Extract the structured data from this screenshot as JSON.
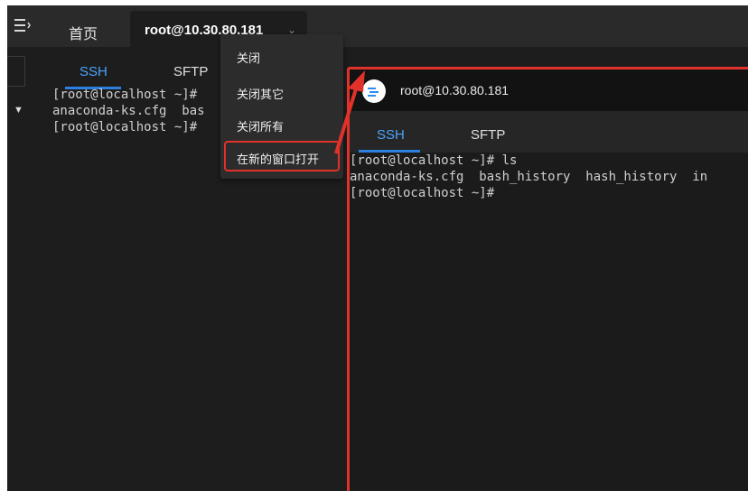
{
  "topbar": {
    "menu_icon": "hamburger-menu-icon",
    "home_tab": "首页",
    "session_tab": "root@10.30.80.181",
    "session_tab_chevron": "⌄"
  },
  "left_pane": {
    "tabs": [
      "SSH",
      "SFTP"
    ],
    "terminal_lines": [
      "[root@localhost ~]#",
      "anaconda-ks.cfg  bas",
      "[root@localhost ~]#"
    ],
    "caret": "▼"
  },
  "context_menu": {
    "items": [
      "关闭",
      "关闭其它",
      "关闭所有",
      "在新的窗口打开"
    ]
  },
  "new_window": {
    "title": "root@10.30.80.181",
    "logo_icon": "app-logo-icon",
    "tabs": [
      "SSH",
      "SFTP"
    ],
    "terminal_lines": [
      "[root@localhost ~]# ls",
      "anaconda-ks.cfg  bash_history  hash_history  in",
      "[root@localhost ~]#"
    ]
  },
  "colors": {
    "highlight": "#e0322b",
    "accent": "#4aa3ff",
    "background": "#1d1d1d"
  }
}
